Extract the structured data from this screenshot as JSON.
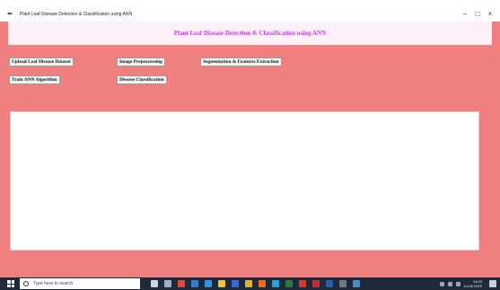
{
  "window": {
    "title": "Plant Leaf Disease Detection & Classification using ANN",
    "controls": {
      "minimize": "–",
      "maximize": "□",
      "close": "×"
    }
  },
  "header": {
    "title": "Plant Leaf Disease Detection & Classification using ANN"
  },
  "buttons": {
    "upload": "Upload Leaf Disease Dataset",
    "preprocess": "Image Preprocessing",
    "segment": "Segmentation & Features Extraction",
    "train": "Train ANN Algorithm",
    "classify": "Disease Classification"
  },
  "output_text": "",
  "taskbar": {
    "search_placeholder": "Type here to search",
    "time": "14:03",
    "date": "14-06-2022"
  },
  "colors": {
    "background": "#f08080",
    "header_text": "#d43cf0",
    "header_bg": "#fdf0f8"
  }
}
